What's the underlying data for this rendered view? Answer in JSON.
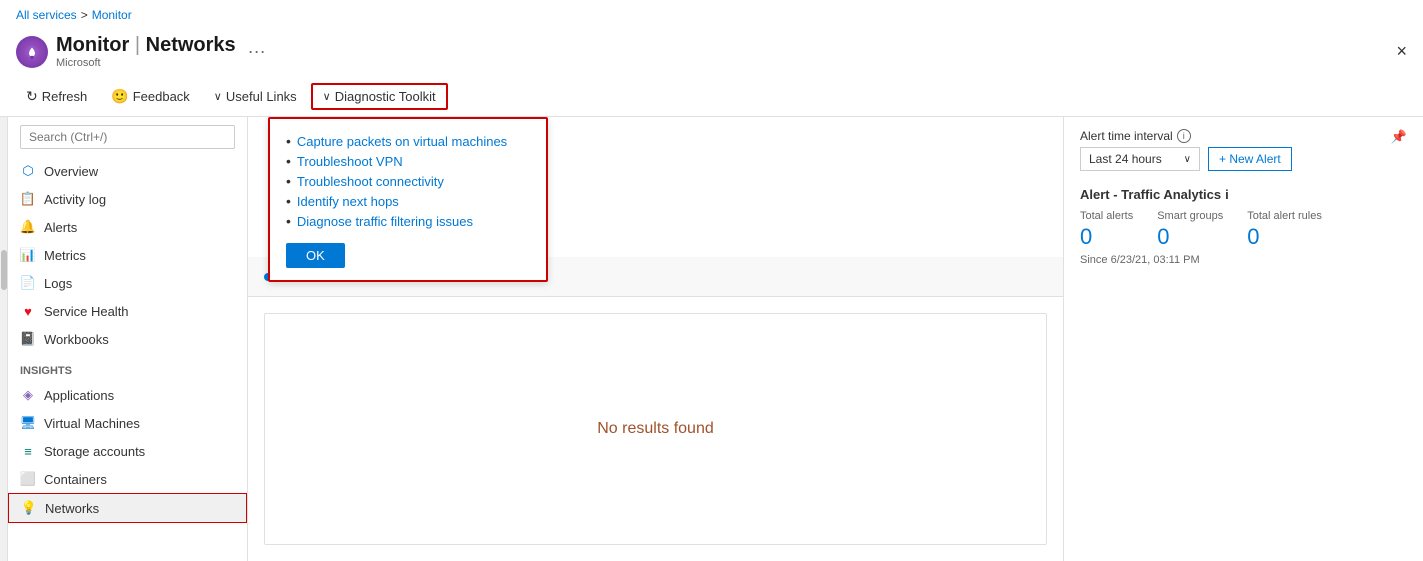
{
  "breadcrumb": {
    "all_services": "All services",
    "separator": ">",
    "monitor": "Monitor"
  },
  "header": {
    "title": "Monitor | Networks",
    "title_first": "Monitor",
    "title_separator": " | ",
    "title_second": "Networks",
    "subtitle": "Microsoft",
    "ellipsis": "···"
  },
  "toolbar": {
    "refresh_label": "Refresh",
    "feedback_label": "Feedback",
    "useful_links_label": "Useful Links",
    "diagnostic_toolkit_label": "Diagnostic Toolkit",
    "close_label": "×"
  },
  "sidebar": {
    "search_placeholder": "Search (Ctrl+/)",
    "items": [
      {
        "id": "overview",
        "label": "Overview",
        "icon": "overview-icon"
      },
      {
        "id": "activity-log",
        "label": "Activity log",
        "icon": "activity-log-icon"
      },
      {
        "id": "alerts",
        "label": "Alerts",
        "icon": "alerts-icon"
      },
      {
        "id": "metrics",
        "label": "Metrics",
        "icon": "metrics-icon"
      },
      {
        "id": "logs",
        "label": "Logs",
        "icon": "logs-icon"
      },
      {
        "id": "service-health",
        "label": "Service Health",
        "icon": "service-health-icon"
      },
      {
        "id": "workbooks",
        "label": "Workbooks",
        "icon": "workbooks-icon"
      }
    ],
    "insights_label": "Insights",
    "insights_items": [
      {
        "id": "applications",
        "label": "Applications",
        "icon": "applications-icon"
      },
      {
        "id": "virtual-machines",
        "label": "Virtual Machines",
        "icon": "vm-icon"
      },
      {
        "id": "storage-accounts",
        "label": "Storage accounts",
        "icon": "storage-icon"
      },
      {
        "id": "containers",
        "label": "Containers",
        "icon": "containers-icon"
      },
      {
        "id": "networks",
        "label": "Networks",
        "icon": "networks-icon",
        "active": true
      }
    ]
  },
  "dropdown": {
    "items": [
      {
        "label": "Capture packets on virtual machines",
        "href": "#"
      },
      {
        "label": "Troubleshoot VPN",
        "href": "#"
      },
      {
        "label": "Troubleshoot connectivity",
        "href": "#"
      },
      {
        "label": "Identify next hops",
        "href": "#"
      },
      {
        "label": "Diagnose traffic filtering issues",
        "href": "#"
      }
    ],
    "ok_button": "OK"
  },
  "main_content": {
    "no_results_text": "No results found"
  },
  "right_panel": {
    "alert_interval_label": "Alert time interval",
    "interval_value": "Last 24 hours",
    "new_alert_button": "+ New Alert",
    "traffic_analytics_title": "Alert - Traffic Analytics",
    "total_alerts_label": "Total alerts",
    "total_alerts_value": "0",
    "smart_groups_label": "Smart groups",
    "smart_groups_value": "0",
    "total_alert_rules_label": "Total alert rules",
    "total_alert_rules_value": "0",
    "since_text": "Since 6/23/21, 03:11 PM"
  }
}
